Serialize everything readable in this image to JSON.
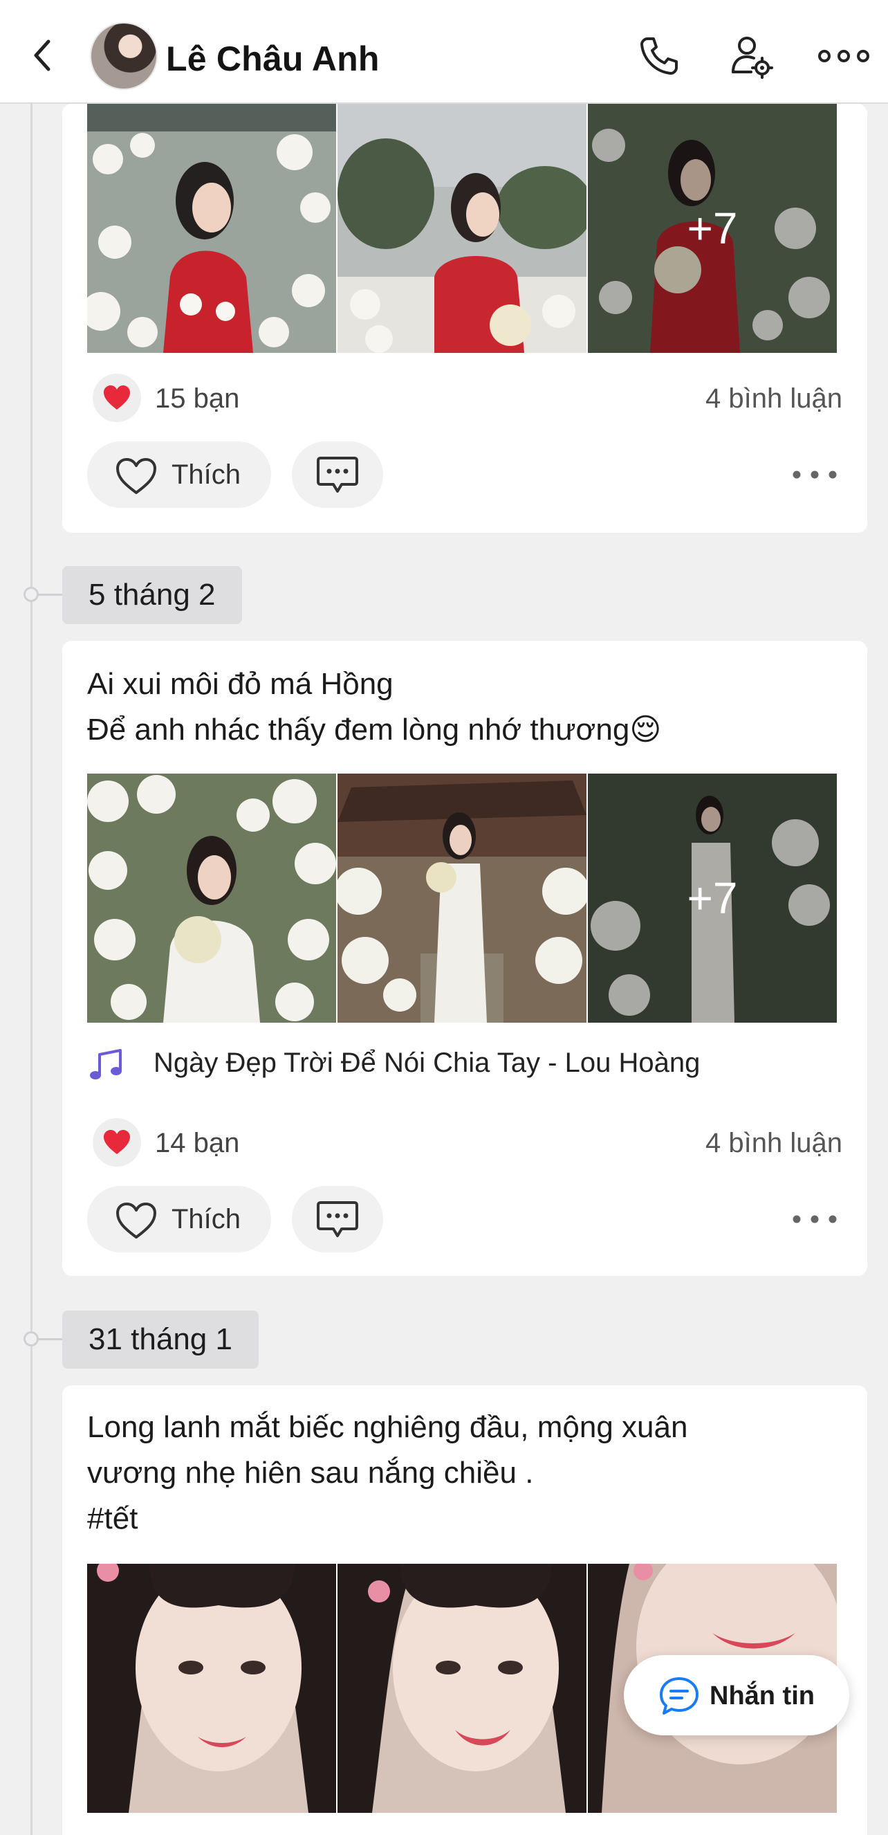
{
  "header": {
    "title": "Lê Châu Anh",
    "back_icon": "back-chevron-icon",
    "call_icon": "phone-icon",
    "settings_icon": "user-settings-icon",
    "more_icon": "more-dots-icon"
  },
  "posts": [
    {
      "date": "",
      "photos_more": "+7",
      "reactions": "15 bạn",
      "comments": "4 bình luận",
      "like_label": "Thích"
    },
    {
      "date": "5 tháng 2",
      "text_lines": [
        "Ai xui môi đỏ má Hồng",
        "Để anh nhác thấy đem lòng nhớ thương😌"
      ],
      "photos_more": "+7",
      "music": "Ngày Đẹp Trời Để Nói Chia Tay - Lou Hoàng",
      "reactions": "14 bạn",
      "comments": "4 bình luận",
      "like_label": "Thích"
    },
    {
      "date": "31 tháng 1",
      "text_lines": [
        "Long lanh mắt biếc nghiêng đầu, mộng xuân",
        "vương nhẹ hiên sau nắng chiều .",
        "#tết"
      ]
    }
  ],
  "message_button": {
    "label": "Nhắn tin"
  },
  "colors": {
    "heart": "#e8283b",
    "music_note": "#6b5bd6",
    "message_icon": "#1a7cf2"
  }
}
